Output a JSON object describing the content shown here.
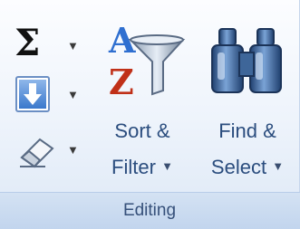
{
  "group": {
    "label": "Editing"
  },
  "autosum": {
    "icon": "sigma-icon",
    "symbol": "Σ",
    "dropdown": "▼"
  },
  "fill": {
    "icon": "fill-down-icon",
    "dropdown": "▼"
  },
  "clear": {
    "icon": "eraser-icon",
    "dropdown": "▼"
  },
  "sort_filter": {
    "line1": "Sort &",
    "line2": "Filter",
    "dropdown": "▼",
    "icon": "sort-az-filter-icon"
  },
  "find_select": {
    "line1": "Find &",
    "line2": "Select",
    "dropdown": "▼",
    "icon": "binoculars-icon"
  },
  "colors": {
    "label_text": "#2b4d7e",
    "accent_blue": "#2f6fd0",
    "sort_red": "#c03018"
  }
}
